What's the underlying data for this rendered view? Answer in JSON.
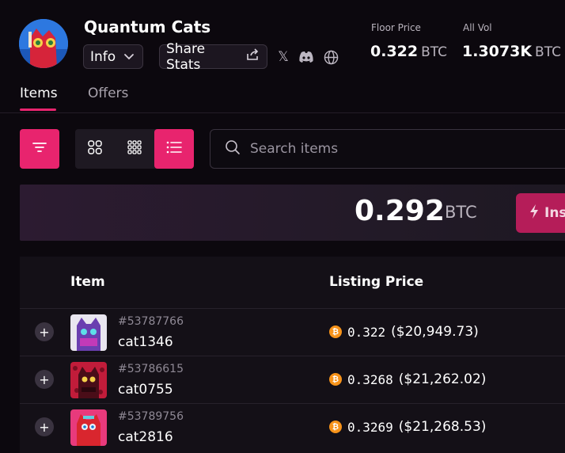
{
  "collection": {
    "name": "Quantum Cats",
    "info_label": "Info",
    "share_label": "Share Stats"
  },
  "stats": {
    "floor_label": "Floor Price",
    "floor_value": "0.322",
    "floor_unit": "BTC",
    "vol_label": "All Vol",
    "vol_value": "1.3073K",
    "vol_unit": "BTC"
  },
  "tabs": [
    {
      "label": "Items",
      "active": true
    },
    {
      "label": "Offers",
      "active": false
    }
  ],
  "search": {
    "placeholder": "Search items"
  },
  "banner": {
    "price": "0.292",
    "unit": "BTC",
    "button_label": "Ins"
  },
  "table": {
    "headers": [
      "Item",
      "Listing Price"
    ],
    "rows": [
      {
        "inscription": "#53787766",
        "name": "cat1346",
        "btc": "0.322",
        "usd": "($20,949.73)",
        "thumb_bg": "#e9e6f0",
        "cat_color": "#6a3fb0"
      },
      {
        "inscription": "#53786615",
        "name": "cat0755",
        "btc": "0.3268",
        "usd": "($21,262.02)",
        "thumb_bg": "#c11c3a",
        "cat_color": "#4a0d18"
      },
      {
        "inscription": "#53789756",
        "name": "cat2816",
        "btc": "0.3269",
        "usd": "($21,268.53)",
        "thumb_bg": "#e83a7c",
        "cat_color": "#d9262e"
      }
    ]
  },
  "colors": {
    "accent": "#e8246e",
    "background": "#0c080e",
    "btc": "#f7931a"
  },
  "icons": {
    "x_glyph": "𝕏"
  }
}
